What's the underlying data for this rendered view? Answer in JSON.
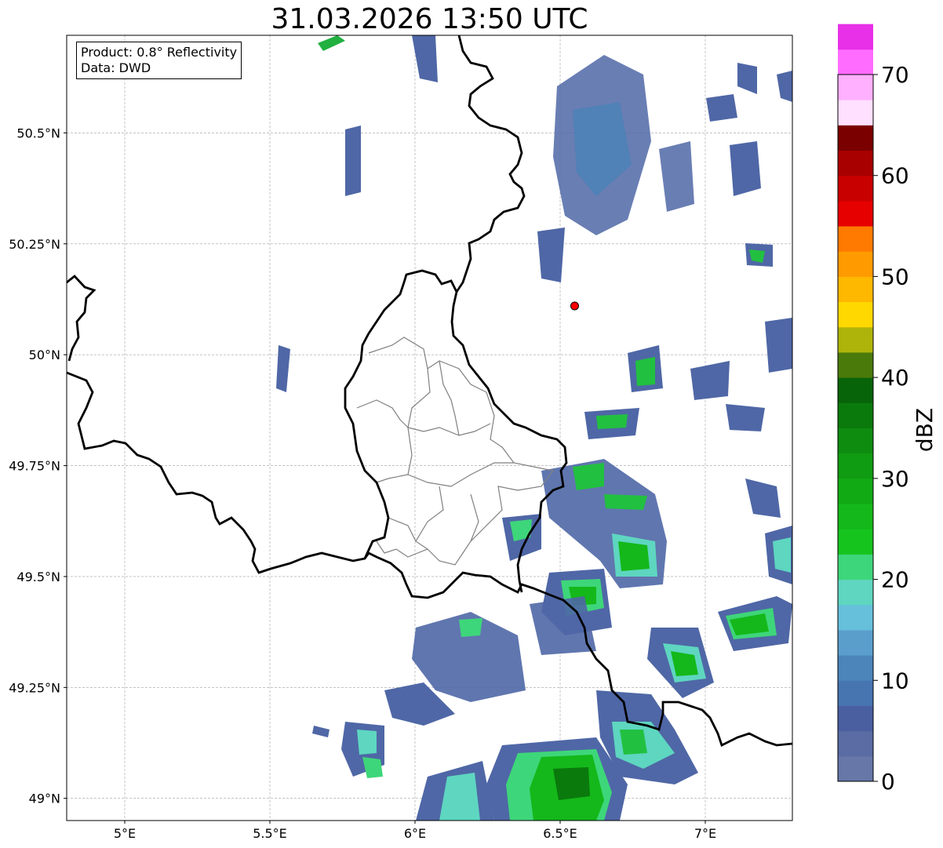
{
  "title": "31.03.2026 13:50 UTC",
  "info": {
    "product": "Product: 0.8° Reflectivity",
    "source": "Data: DWD"
  },
  "map_extent": {
    "lon": [
      4.8,
      7.3
    ],
    "lat": [
      48.95,
      50.72
    ]
  },
  "lon_ticks": [
    {
      "value": 5.0,
      "label": "5°E"
    },
    {
      "value": 5.5,
      "label": "5.5°E"
    },
    {
      "value": 6.0,
      "label": "6°E"
    },
    {
      "value": 6.5,
      "label": "6.5°E"
    },
    {
      "value": 7.0,
      "label": "7°E"
    }
  ],
  "lat_ticks": [
    {
      "value": 50.5,
      "label": "50.5°N"
    },
    {
      "value": 50.25,
      "label": "50.25°N"
    },
    {
      "value": 50.0,
      "label": "50°N"
    },
    {
      "value": 49.75,
      "label": "49.75°N"
    },
    {
      "value": 49.5,
      "label": "49.5°N"
    },
    {
      "value": 49.25,
      "label": "49.25°N"
    },
    {
      "value": 49.0,
      "label": "49°N"
    }
  ],
  "radar_site": {
    "lon": 6.55,
    "lat": 50.11,
    "color": "#ff0000"
  },
  "colorbar": {
    "label": "dBZ",
    "min": 0,
    "max": 70,
    "step": 2.5,
    "tick_labels": [
      "0",
      "10",
      "20",
      "30",
      "40",
      "50",
      "60",
      "70"
    ],
    "colors": [
      "#6677a8",
      "#5a6ca3",
      "#4a5fa0",
      "#4675b0",
      "#4c85ba",
      "#5a9fcc",
      "#66c0dc",
      "#5ed6c0",
      "#3ed67a",
      "#16c41e",
      "#14b81a",
      "#12aa14",
      "#109c12",
      "#0e8c10",
      "#0a7a0c",
      "#086408",
      "#4a7a0a",
      "#aeb40a",
      "#ffd800",
      "#ffb800",
      "#ff9a00",
      "#ff7a00",
      "#e60000",
      "#c80000",
      "#a80000",
      "#7a0000",
      "#ffe0ff",
      "#ffb0ff",
      "#ff6cff",
      "#e830e8"
    ]
  }
}
